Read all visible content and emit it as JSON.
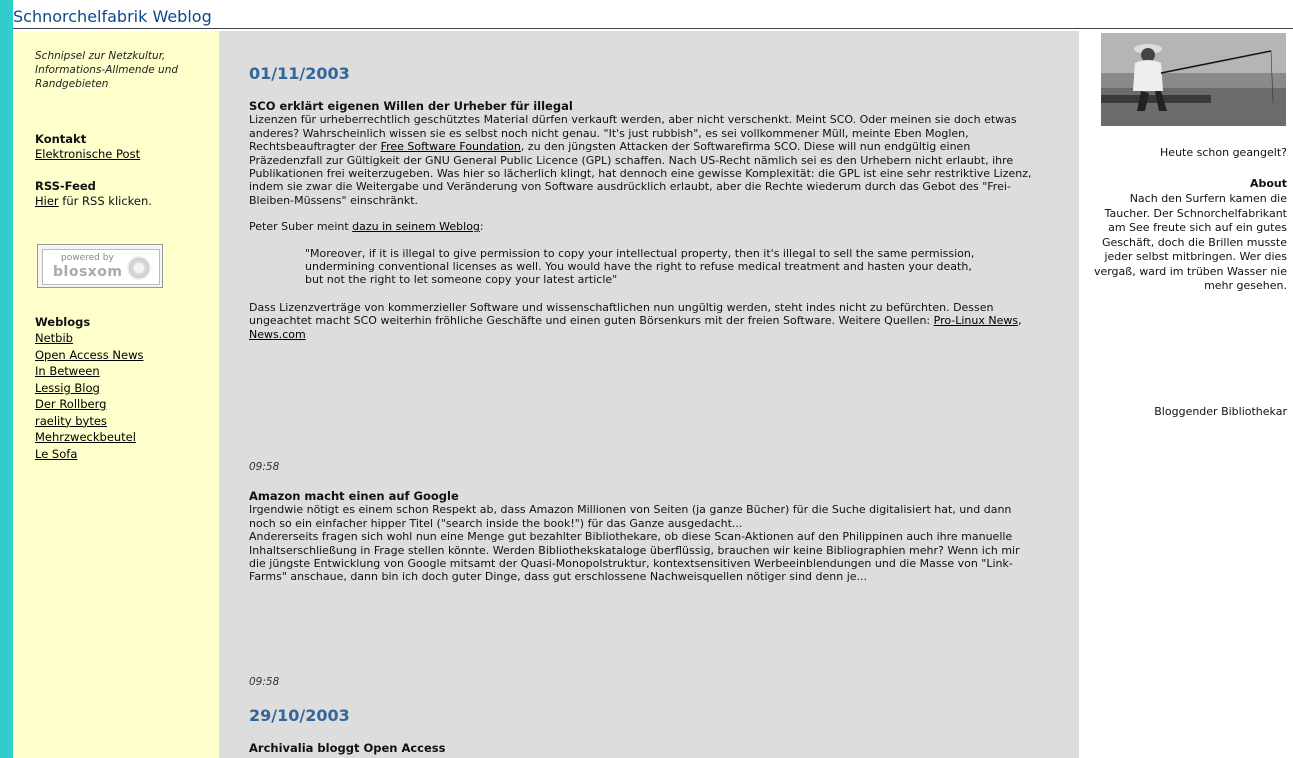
{
  "site": {
    "title": "Schnorchelfabrik Weblog"
  },
  "left": {
    "tagline": "Schnipsel zur Netzkultur, Informations-Allmende und Randgebieten",
    "contact_heading": "Kontakt",
    "contact_link": "Elektronische Post",
    "rss_heading": "RSS-Feed",
    "rss_link": "Hier",
    "rss_rest": " für RSS klicken.",
    "badge_top": "powered by",
    "badge_main": "blosxom",
    "weblogs_heading": "Weblogs",
    "weblogs": [
      "Netbib",
      "Open Access News",
      "In Between",
      "Lessig Blog",
      "Der Rollberg",
      "raelity bytes",
      "Mehrzweckbeutel",
      "Le Sofa"
    ]
  },
  "main": {
    "date1": "01/11/2003",
    "post1": {
      "title": "SCO erklärt eigenen Willen der Urheber für illegal",
      "p1a": "Lizenzen für urheberrechtlich geschütztes Material dürfen verkauft werden, aber nicht verschenkt. Meint SCO. Oder meinen sie doch etwas anderes? Wahrscheinlich wissen sie es selbst noch nicht genau. \"It's just rubbish\", es sei vollkommener Müll, meinte Eben Moglen, Rechtsbeauftragter der ",
      "p1_link": "Free Software Foundation",
      "p1b": ", zu den jüngsten Attacken der Softwarefirma SCO. Diese will nun endgültig einen Präzedenzfall zur Gültigkeit der GNU General Public Licence (GPL) schaffen. Nach US-Recht nämlich sei es den Urhebern nicht erlaubt, ihre Publikationen frei weiterzugeben. Was hier so lächerlich klingt, hat dennoch eine gewisse Komplexität: die GPL ist eine sehr restriktive Lizenz, indem sie zwar die Weitergabe und Veränderung von Software ausdrücklich erlaubt, aber die Rechte wiederum durch das Gebot des \"Frei-Bleiben-Müssens\" einschränkt.",
      "p2a": "Peter Suber meint ",
      "p2_link": "dazu in seinem Weblog",
      "p2b": ":",
      "quote": "\"Moreover, if it is illegal to give permission to copy your intellectual property, then it's illegal to sell the same permission, undermining conventional licenses as well. You would have the right to refuse medical treatment and hasten your death, but not the right to let someone copy your latest article\"",
      "p3a": "Dass Lizenzverträge von kommerzieller Software und wissenschaftlichen nun ungültig werden, steht indes nicht zu befürchten. Dessen ungeachtet macht SCO weiterhin fröhliche Geschäfte und einen guten Börsenkurs mit der freien Software. Weitere Quellen: ",
      "p3_link1": "Pro-Linux News",
      "p3_sep": ", ",
      "p3_link2": "News.com",
      "time": "09:58"
    },
    "post2": {
      "title": "Amazon macht einen auf Google",
      "p1": "Irgendwie nötigt es einem schon Respekt ab, dass Amazon Millionen von Seiten (ja ganze Bücher) für die Suche digitalisiert hat, und dann noch so ein einfacher hipper Titel (\"search inside the book!\") für das Ganze ausgedacht...",
      "p2": "Andererseits fragen sich wohl nun eine Menge gut bezahlter Bibliothekare, ob diese Scan-Aktionen auf den Philippinen auch ihre manuelle Inhaltserschließung in Frage stellen könnte. Werden Bibliothekskataloge überflüssig, brauchen wir keine Bibliographien mehr? Wenn ich mir die jüngste Entwicklung von Google mitsamt der Quasi-Monopolstruktur, kontextsensitiven Werbeeinblendungen und die Masse von \"Link-Farms\" anschaue, dann bin ich doch guter Dinge, dass gut erschlossene Nachweisquellen nötiger sind denn je...",
      "time": "09:58"
    },
    "date2": "29/10/2003",
    "post3": {
      "title": "Archivalia bloggt Open Access"
    }
  },
  "right": {
    "caption": "Heute schon geangelt?",
    "about_heading": "About",
    "about_text": "Nach den Surfern kamen die Taucher. Der Schnorchelfabrikant am See freute sich auf ein gutes Geschäft, doch die Brillen musste jeder selbst mitbringen. Wer dies vergaß, ward im trüben Wasser nie mehr gesehen.",
    "signature": "Bloggender Bibliothekar"
  },
  "colors": {
    "background": "#33cccc",
    "left_column": "#ffffcc",
    "main_column": "#dddddd",
    "date_heading": "#336699",
    "title": "#0b4a8a"
  }
}
